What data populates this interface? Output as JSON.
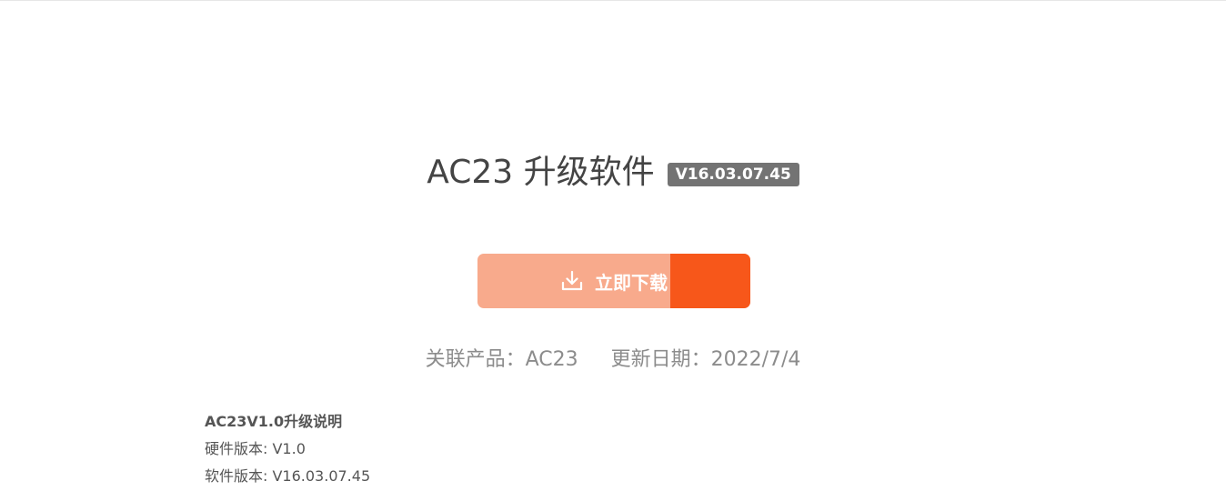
{
  "header": {
    "title": "AC23 升级软件",
    "version_badge": "V16.03.07.45"
  },
  "download": {
    "label": "立即下载",
    "icon": "download-icon",
    "progress_percent": 29.3,
    "colors": {
      "base": "#f8aa8c",
      "progress": "#f7571a",
      "text": "#ffffff"
    }
  },
  "meta": {
    "related_product": "关联产品：AC23",
    "update_date": "更新日期：2022/7/4"
  },
  "release_notes": {
    "heading": "AC23V1.0升级说明",
    "lines": [
      "硬件版本: V1.0",
      "软件版本: V16.03.07.45"
    ]
  }
}
